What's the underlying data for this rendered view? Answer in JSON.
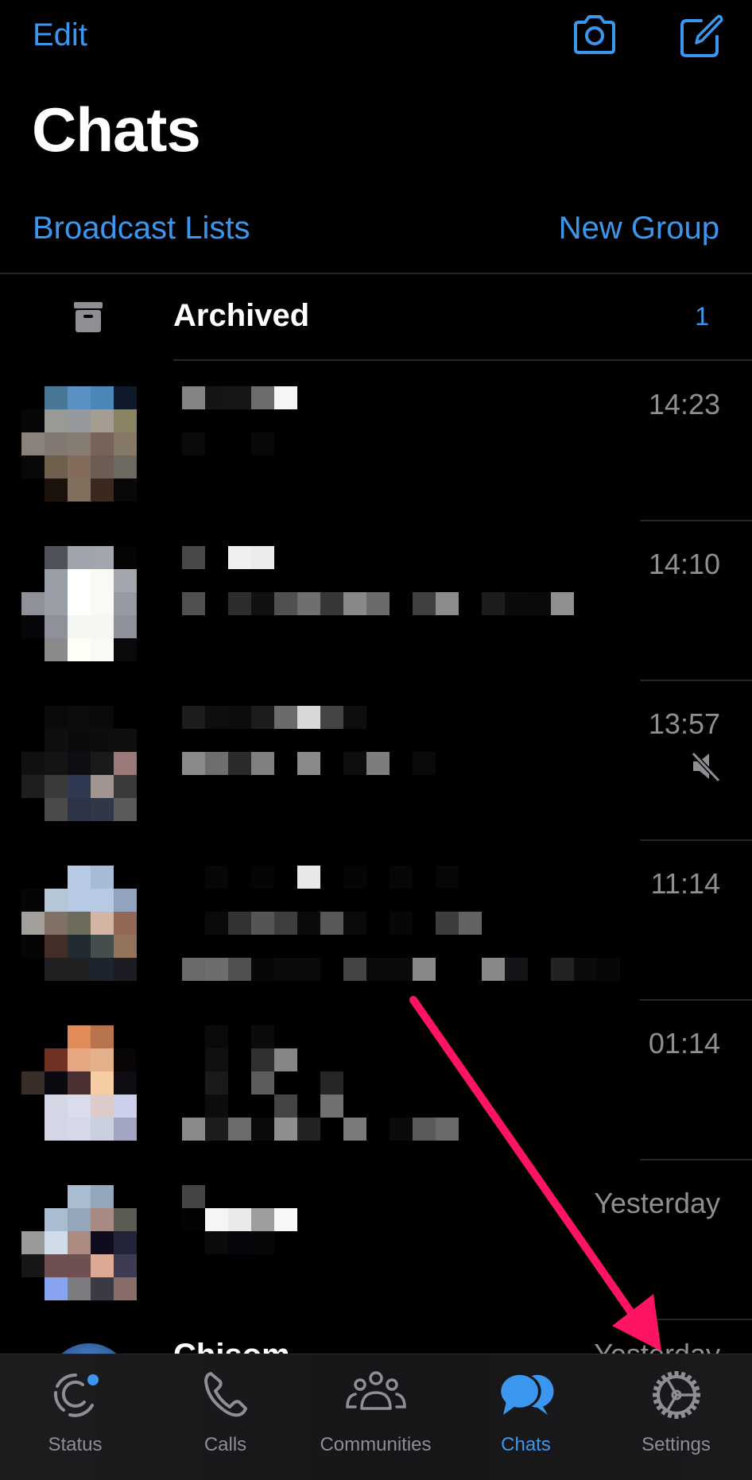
{
  "header": {
    "edit_label": "Edit",
    "camera_icon": "camera-icon",
    "compose_icon": "compose-icon",
    "title": "Chats",
    "broadcast_label": "Broadcast Lists",
    "new_group_label": "New Group"
  },
  "archived": {
    "icon": "archive-box-icon",
    "label": "Archived",
    "count": "1"
  },
  "colors": {
    "accent": "#3b97ee",
    "secondary_text": "#8e8e93",
    "annotation_arrow": "#ff1464"
  },
  "chats": [
    {
      "time": "14:23",
      "muted": false,
      "avatar_pixelated": [
        [
          "",
          "#487895",
          "#5a90c3",
          "#4b87b8",
          "#0e1a2a"
        ],
        [
          "#07070a",
          "#989b93",
          "#95989c",
          "#a59d92",
          "#8b8462"
        ],
        [
          "#8a827a",
          "#827a72",
          "#857d72",
          "#776358",
          "#877968"
        ],
        [
          "#08080a",
          "#6f604d",
          "#846c5c",
          "#6b5d53",
          "#6e6a62"
        ],
        [
          "",
          "#1c120c",
          "#82705e",
          "#3b2920",
          "#0a0806"
        ]
      ],
      "preview_pixelated": [
        [
          "#838383",
          "#151515",
          "#161616",
          "#6c6c6c",
          "#f5f5f5"
        ],
        [],
        [
          "#0a0a0c",
          "",
          "",
          "#08080a",
          ""
        ]
      ]
    },
    {
      "time": "14:10",
      "muted": false,
      "avatar_pixelated": [
        [
          "",
          "#505259",
          "#a0a3ab",
          "#a2a5ad",
          "#050505"
        ],
        [
          "",
          "#9a9ea6",
          "#ffffff",
          "#fafaf5",
          "#a3a6ad"
        ],
        [
          "#8e9199",
          "#9a9ea6",
          "#ffffff",
          "#fafaf5",
          "#979aa2"
        ],
        [
          "#06060a",
          "#8e9199",
          "#f5f7f2",
          "#f5f7f2",
          "#8e9199"
        ],
        [
          "",
          "#8a8a8a",
          "#fefef7",
          "#fafaf5",
          "#0a0a0c"
        ]
      ],
      "preview_pixelated": [
        [
          "#484848",
          "",
          "#f0f0f0",
          "#ebebeb"
        ],
        [],
        [
          "#505050",
          "",
          "#2d2d2d",
          "#111111",
          "#505050",
          "#6f6f6f",
          "#373737",
          "#888888",
          "#6b6b6b",
          "",
          "#404040",
          "#8b8b8b",
          "",
          "#1c1c1c",
          "#0b0b0b",
          "#0a0a0c",
          "#8f8f8f"
        ]
      ]
    },
    {
      "time": "13:57",
      "muted": true,
      "avatar_pixelated": [
        [
          "",
          "#0a0a0a",
          "#0c0c0c",
          "#0a0a0a",
          ""
        ],
        [
          "",
          "#0f0f0f",
          "#0b0b0b",
          "#0d0d0d",
          "#0f0f0f"
        ],
        [
          "#101010",
          "#151313",
          "#100c14",
          "#1a1a1a",
          "#9a7a78"
        ],
        [
          "#1e1e1e",
          "#3a3a3a",
          "#2d3a52",
          "#a09590",
          "#3a3a3a"
        ],
        [
          "",
          "#4a4a4a",
          "#2e3448",
          "#303848",
          "#5a5a5a"
        ]
      ],
      "preview_pixelated": [
        [
          "#1c1c1c",
          "#0e0e0e",
          "#0c0c0c",
          "#1c1c1c",
          "#6b6b6b",
          "#d8d8d8",
          "#444444",
          "#0e0e0e"
        ],
        [],
        [
          "#8a8a8a",
          "#6e6e6e",
          "#2a2a2a",
          "#808080",
          "",
          "#8a8a8a",
          "",
          "#0e0e0e",
          "#7d7d80",
          "",
          "#0a0a0a"
        ]
      ]
    },
    {
      "time": "11:14",
      "muted": false,
      "avatar_pixelated": [
        [
          "",
          "",
          "#b7c9e5",
          "#a6bcd4",
          ""
        ],
        [
          "#050505",
          "#b5c6d7",
          "#b7c9e5",
          "#b7c9e5",
          "#93a3bd"
        ],
        [
          "#a29f9a",
          "#817166",
          "#6d6c5c",
          "#d3b5a3",
          "#936857"
        ],
        [
          "#050505",
          "#432f28",
          "#222a32",
          "#434e4d",
          "#94735b"
        ],
        [
          "",
          "#212124",
          "#212124",
          "#1e2330",
          "#1d1b24"
        ]
      ],
      "preview_pixelated": [
        [
          "",
          "#060606",
          "",
          "#050505",
          "",
          "#e8e8e8",
          "",
          "#050505",
          "",
          "#060606",
          "",
          "#060606"
        ],
        [],
        [
          "",
          "#0a0a0a",
          "#323234",
          "#555555",
          "#3e3e3e",
          "#0b0b0d",
          "#58585a",
          "#0b0b0d",
          "",
          "#07070a",
          "",
          "#3d3d3d",
          "#626262"
        ],
        [],
        [
          "#6a6a6a",
          "#6d6d6f",
          "#4f5052",
          "#07070a",
          "#0a0a08",
          "#0a0a0c",
          "",
          "#444444",
          "#0a0a0c",
          "#0a0a0c",
          "#888888",
          "",
          "",
          "#888888",
          "#141418",
          "",
          "#232323",
          "#0b0b0b",
          "#07070a"
        ]
      ]
    },
    {
      "time": "01:14",
      "muted": false,
      "avatar_pixelated": [
        [
          "",
          "",
          "#e08c58",
          "#b7744e",
          ""
        ],
        [
          "",
          "#6f3223",
          "#e5a882",
          "#e2b08a",
          "#0a0505"
        ],
        [
          "#3a2e28",
          "#0a0a10",
          "#4a3030",
          "#f5cca4",
          "#0f0c14"
        ],
        [
          "",
          "#d4d6e6",
          "#d8dcec",
          "#dccbc8",
          "#ccd0ec"
        ],
        [
          "",
          "#d4d6e6",
          "#d6d8e8",
          "#cad0e0",
          "#a2a6c2"
        ]
      ],
      "preview_pixelated": [
        [
          "",
          "#0a0a0a",
          "",
          "#0b0b0b"
        ],
        [
          "",
          "#101010",
          "",
          "#303030",
          "#868686"
        ],
        [
          "",
          "#1a1a1a",
          "",
          "#5c5c5c",
          "",
          "",
          "#262626"
        ],
        [
          "",
          "#0c0c0c",
          "",
          "",
          "#444444",
          "",
          "#707070"
        ],
        [
          "#8a8a8a",
          "#1d1d1d",
          "#6c6c6c",
          "#0a0a0c",
          "#8e8e8e",
          "#232323",
          "",
          "#7a7a7a",
          "",
          "#0b0b0b",
          "#5a5a5a",
          "#6a6a6a"
        ]
      ]
    },
    {
      "time": "Yesterday",
      "muted": false,
      "avatar_pixelated": [
        [
          "",
          "",
          "#aabdd0",
          "#94a6ba",
          ""
        ],
        [
          "",
          "#aabdd0",
          "#94a6ba",
          "#a88a84",
          "#5a5c54"
        ],
        [
          "#9a9a9a",
          "#d0dcea",
          "#ac8a80",
          "#100c20",
          "#22243a"
        ],
        [
          "#161616",
          "#6e5052",
          "#6e5052",
          "#dcaa94",
          "#3e3c52"
        ],
        [
          "",
          "#88a4f0",
          "#7c7c80",
          "#3a3a44",
          "#8a6c68"
        ]
      ],
      "preview_pixelated": [
        [
          "#444444"
        ],
        [
          "#030303",
          "#f5f5f5",
          "#eaeaea",
          "#9e9e9e",
          "#f7f7f7"
        ],
        [
          "",
          "#0a0a0a",
          "#05050a",
          "#07070a"
        ]
      ]
    },
    {
      "name": "Chisom",
      "time": "Yesterday",
      "muted": false
    }
  ],
  "tabbar": {
    "tabs": [
      {
        "label": "Status",
        "icon": "status-icon",
        "active": false,
        "has_badge_dot": true
      },
      {
        "label": "Calls",
        "icon": "phone-icon",
        "active": false
      },
      {
        "label": "Communities",
        "icon": "communities-icon",
        "active": false
      },
      {
        "label": "Chats",
        "icon": "chat-bubbles-icon",
        "active": true
      },
      {
        "label": "Settings",
        "icon": "gear-icon",
        "active": false
      }
    ]
  },
  "annotation": {
    "type": "arrow",
    "points_to": "Settings tab"
  }
}
